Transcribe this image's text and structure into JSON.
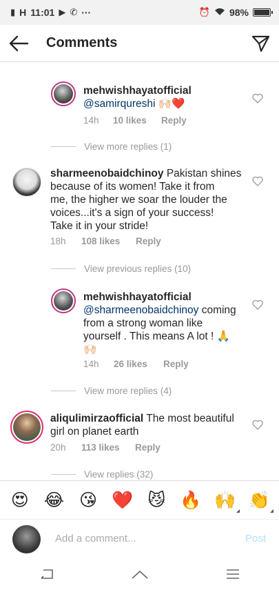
{
  "status_bar": {
    "carrier_signal": "H",
    "time": "11:01",
    "more": "···",
    "battery_text": "98%",
    "battery_level": 0.98
  },
  "header": {
    "title": "Comments",
    "back_icon": "arrow-left-icon",
    "send_icon": "paper-plane-icon"
  },
  "comments": [
    {
      "username": "mehwishhayatofficial",
      "mention": "@samirqureshi",
      "text": "",
      "emoji": "🙌🏻❤️",
      "time": "14h",
      "likes": "10 likes",
      "reply": "Reply"
    },
    {
      "username": "sharmeenobaidchinoy",
      "text_lines": [
        "Pakistan shines",
        "because of its women! Take it from",
        "me, the higher we soar the louder the",
        "voices...it's a sign of your success!",
        "Take it in your stride!"
      ],
      "time": "18h",
      "likes": "108 likes",
      "reply": "Reply"
    },
    {
      "username": "mehwishhayatofficial",
      "mention": "@sharmeenobaidchinoy",
      "text_lines": [
        " coming",
        "from a strong woman like",
        "yourself . This means A lot ! 🙏"
      ],
      "extra_emoji": "🙌🏻",
      "time": "14h",
      "likes": "26 likes",
      "reply": "Reply"
    },
    {
      "username": "aliqulimirzaofficial",
      "text_lines": [
        "The most beautiful",
        "girl on planet earth"
      ],
      "time": "20h",
      "likes": "113 likes",
      "reply": "Reply"
    }
  ],
  "reply_threads": {
    "view_more_1": "View more replies (1)",
    "view_previous_10": "View previous replies (10)",
    "view_more_4": "View more replies (4)",
    "view_32": "View replies (32)"
  },
  "emoji_bar": [
    "😍",
    "😂",
    "😘",
    "❤️",
    "😼",
    "🔥",
    "🙌",
    "👏"
  ],
  "composer": {
    "placeholder": "Add a comment...",
    "post_label": "Post"
  },
  "colors": {
    "mention": "#003569",
    "meta": "#999999",
    "post_disabled": "#b2dffc",
    "story_ring": "#c13584"
  }
}
